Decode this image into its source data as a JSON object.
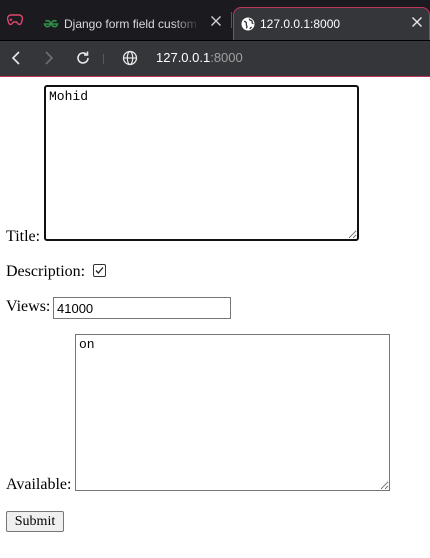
{
  "browser": {
    "tabs": [
      {
        "title": "Django form field custom widgets - GeeksforGeeks",
        "active": false,
        "icon": "geeksforgeeks-icon"
      },
      {
        "title": "127.0.0.1:8000",
        "active": true,
        "icon": "globe-icon"
      }
    ],
    "address": {
      "host": "127.0.0.1",
      "port": ":8000"
    }
  },
  "form": {
    "title_label": "Title:",
    "title_value": "Mohid",
    "description_label": "Description:",
    "description_checked": true,
    "views_label": "Views:",
    "views_value": "41000",
    "available_label": "Available:",
    "available_value": "on",
    "submit_label": "Submit"
  },
  "colors": {
    "tabbar_bg": "#1b1b1f",
    "toolbar_bg": "#35363a",
    "accent": "#c2355a",
    "gfg_green": "#2f8d46"
  }
}
